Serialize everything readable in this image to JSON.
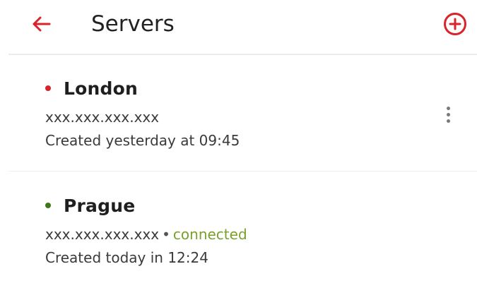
{
  "header": {
    "title": "Servers",
    "back_icon": "arrow-left-icon",
    "add_icon": "plus-circle-icon",
    "accent_color": "#d9222a"
  },
  "servers": [
    {
      "name": "London",
      "status_color": "#d9222a",
      "address": "xxx.xxx.xxx.xxx",
      "created": "Created yesterday at 09:45",
      "menu_icon": "more-vertical-icon"
    },
    {
      "name": "Prague",
      "status_color": "#3f7a1a",
      "address": "xxx.xxx.xxx.xxx",
      "separator": "•",
      "status_text": "connected",
      "status_text_color": "#7a9f2b",
      "created": "Created today in 12:24"
    }
  ]
}
